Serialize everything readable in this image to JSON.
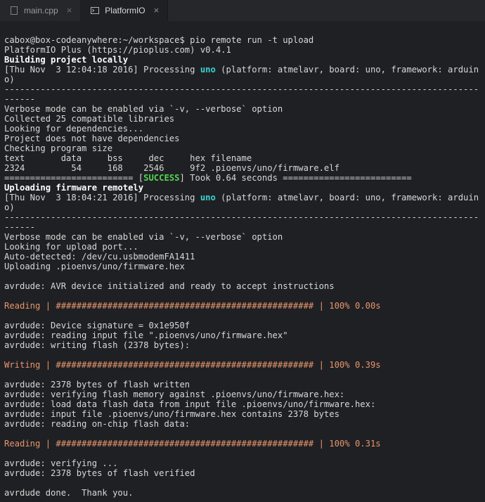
{
  "tabs": {
    "file": {
      "label": "main.cpp"
    },
    "platform": {
      "label": "PlatformIO"
    }
  },
  "term": {
    "prompt": "cabox@box-codeanywhere:~/workspace$ pio remote run -t upload",
    "version": "PlatformIO Plus (https://pioplus.com) v0.4.1",
    "build_hdr": "Building project locally",
    "ts1a": "[Thu Nov  3 12:04:18 2016] Processing ",
    "ts_uno": "uno",
    "ts1b": " (platform: atmelavr, board: uno, framework: arduino)",
    "dash1": "--------------------------------------------------------------------------------------------------",
    "verbose": "Verbose mode can be enabled via `-v, --verbose` option",
    "collected": "Collected 25 compatible libraries",
    "lookdeps": "Looking for dependencies...",
    "nodeps": "Project does not have dependencies",
    "checksize": "Checking program size",
    "size_hdr": "text       data     bss     dec     hex filename",
    "size_row": "2324         54     168    2546     9f2 .pioenvs/uno/firmware.elf",
    "res_a": "========================= [",
    "res_success": "SUCCESS",
    "res_b": "] Took 0.64 seconds =========================",
    "upload_hdr": "Uploading firmware remotely",
    "ts2a": "[Thu Nov  3 18:04:21 2016] Processing ",
    "ts2b": " (platform: atmelavr, board: uno, framework: arduino)",
    "dash2": "--------------------------------------------------------------------------------------------------",
    "lookport": "Looking for upload port...",
    "autodet": "Auto-detected: /dev/cu.usbmodemFA1411",
    "uploading": "Uploading .pioenvs/uno/firmware.hex",
    "av_init": "avrdude: AVR device initialized and ready to accept instructions",
    "read1": "Reading | ################################################## | 100% 0.00s",
    "av_sig": "avrdude: Device signature = 0x1e950f",
    "av_read": "avrdude: reading input file \".pioenvs/uno/firmware.hex\"",
    "av_write": "avrdude: writing flash (2378 bytes):",
    "write1": "Writing | ################################################## | 100% 0.39s",
    "av_w1": "avrdude: 2378 bytes of flash written",
    "av_w2": "avrdude: verifying flash memory against .pioenvs/uno/firmware.hex:",
    "av_w3": "avrdude: load data flash data from input file .pioenvs/uno/firmware.hex:",
    "av_w4": "avrdude: input file .pioenvs/uno/firmware.hex contains 2378 bytes",
    "av_w5": "avrdude: reading on-chip flash data:",
    "read2": "Reading | ################################################## | 100% 0.31s",
    "av_v1": "avrdude: verifying ...",
    "av_v2": "avrdude: 2378 bytes of flash verified",
    "done": "avrdude done.  Thank you."
  }
}
